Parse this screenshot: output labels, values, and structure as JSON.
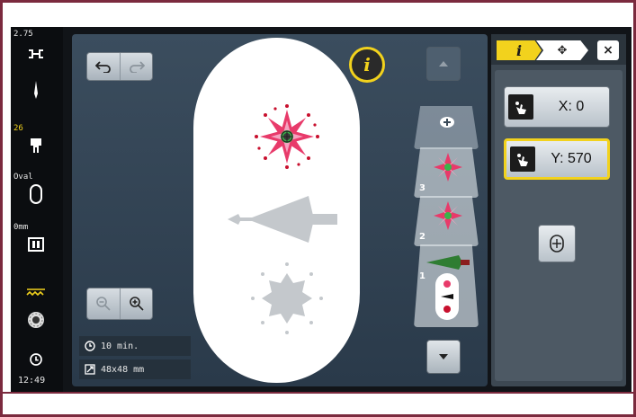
{
  "status_bar": {
    "needle_value": "2.75",
    "presser_foot_value": "26",
    "hoop_label": "Oval",
    "offset_value": "0mm",
    "clock_time": "12:49",
    "icons": [
      "needle-plate-icon",
      "needle-icon",
      "presser-foot-icon",
      "hoop-icon",
      "feed-dog-icon",
      "thread-tension-icon",
      "bobbin-icon",
      "clock-icon"
    ]
  },
  "workspace": {
    "info_badge": "i",
    "stitch_time": "10 min.",
    "design_size": "48x48 mm",
    "icons": [
      "undo-icon",
      "redo-icon",
      "zoom-out-icon",
      "zoom-in-icon",
      "clock-icon",
      "resize-icon"
    ]
  },
  "layers": {
    "numbers": [
      "3",
      "2",
      "1"
    ],
    "icons": [
      "scroll-up-icon",
      "add-layer-icon",
      "scroll-down-icon"
    ]
  },
  "right_panel": {
    "tabs": [
      "i",
      "✥"
    ],
    "close_label": "×",
    "x_label": "X: 0",
    "y_label": "Y: 570",
    "icons": [
      "touch-move-icon",
      "center-design-icon"
    ]
  },
  "colors": {
    "accent_yellow": "#f2d21d",
    "frame_maroon": "#7b2a3e",
    "panel_dark": "#2a3a4a"
  }
}
